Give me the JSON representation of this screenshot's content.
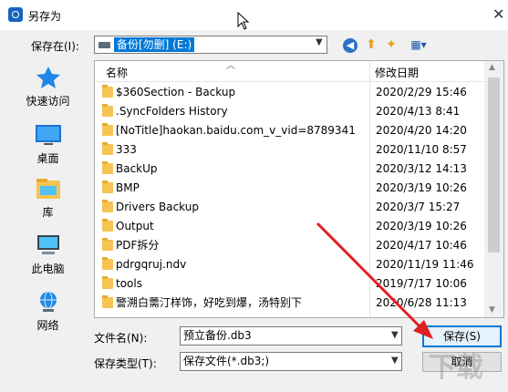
{
  "window": {
    "title": "另存为",
    "close_glyph": "✕"
  },
  "toolbar": {
    "save_in_label": "保存在(I):",
    "location": "备份[勿删] (E:)",
    "back_glyph": "◀",
    "up_glyph": "⬆",
    "new_folder_glyph": "✦",
    "view_glyph": "▦▾"
  },
  "places": [
    {
      "label": "快速访问",
      "icon": "star-icon"
    },
    {
      "label": "桌面",
      "icon": "desktop-icon"
    },
    {
      "label": "库",
      "icon": "library-icon"
    },
    {
      "label": "此电脑",
      "icon": "computer-icon"
    },
    {
      "label": "网络",
      "icon": "network-icon"
    }
  ],
  "file_list": {
    "columns": {
      "name": "名称",
      "modified": "修改日期"
    },
    "rows": [
      {
        "name": "$360Section - Backup",
        "date": "2020/2/29 15:46"
      },
      {
        "name": ".SyncFolders History",
        "date": "2020/4/13 8:41"
      },
      {
        "name": "[NoTitle]haokan.baidu.com_v_vid=8789341",
        "date": "2020/4/20 14:20"
      },
      {
        "name": "333",
        "date": "2020/11/10 8:57"
      },
      {
        "name": "BackUp",
        "date": "2020/3/12 14:13"
      },
      {
        "name": "BMP",
        "date": "2020/3/19 10:26"
      },
      {
        "name": "Drivers Backup",
        "date": "2020/3/7 15:27"
      },
      {
        "name": "Output",
        "date": "2020/3/19 10:26"
      },
      {
        "name": "PDF拆分",
        "date": "2020/4/17 10:46"
      },
      {
        "name": "pdrgqruj.ndv",
        "date": "2020/11/19 11:46"
      },
      {
        "name": "tools",
        "date": "2019/7/17 10:06"
      },
      {
        "name": "警溯白薷汀样饰，好吃到爆，汤特别下",
        "date": "2020/6/28 11:13"
      }
    ]
  },
  "bottom": {
    "filename_label": "文件名(N):",
    "filename_value": "预立备份.db3",
    "filetype_label": "保存类型(T):",
    "filetype_value": "保存文件(*.db3;)",
    "save_button": "保存(S)",
    "cancel_button": "取消"
  },
  "colors": {
    "accent": "#0078d7",
    "annotation_arrow": "#e02020",
    "folder": "#f6c453"
  }
}
